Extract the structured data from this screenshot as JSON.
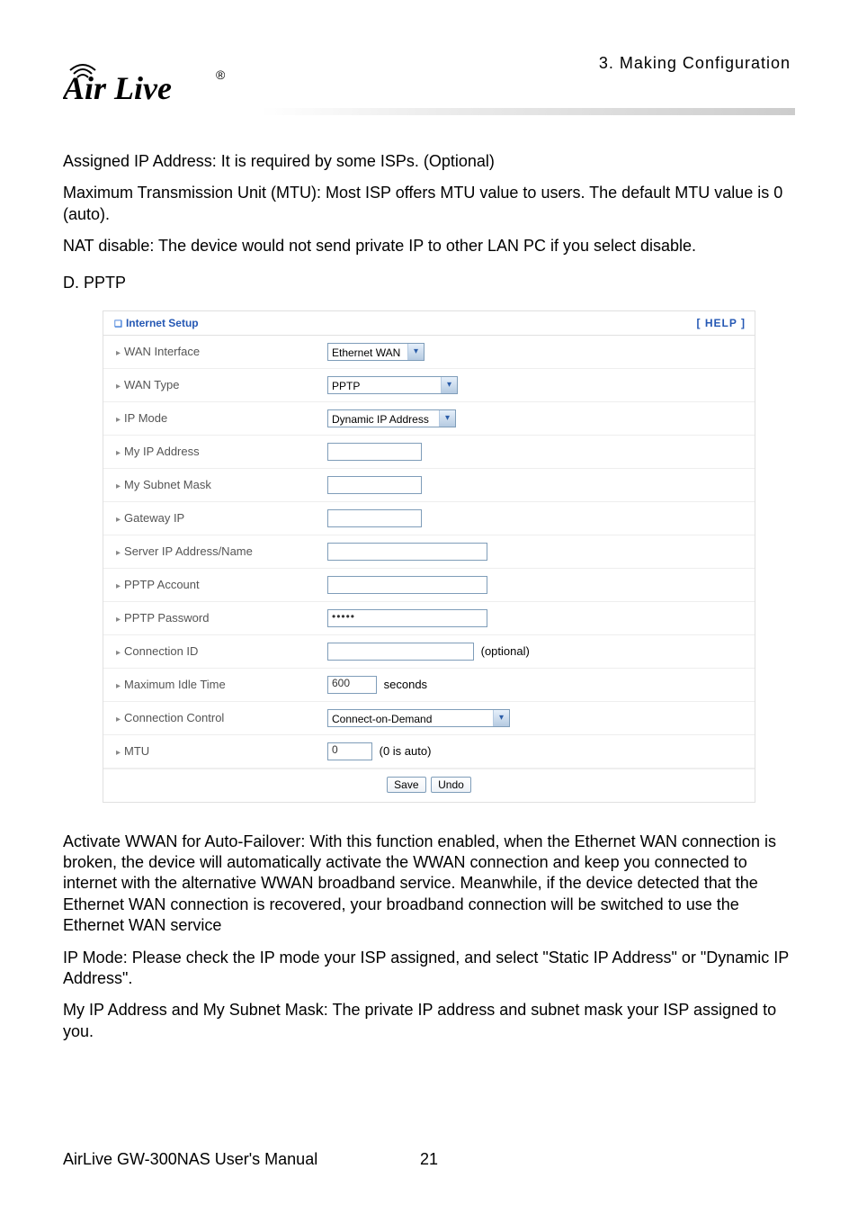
{
  "header": {
    "chapter": "3.  Making  Configuration",
    "logo_text": "Air Live",
    "logo_r": "®"
  },
  "intro": {
    "p1": "Assigned IP Address: It is required by some ISPs. (Optional)",
    "p2": "Maximum Transmission Unit (MTU): Most ISP offers MTU value to users. The default MTU value is 0 (auto).",
    "p3": "NAT disable: The device would not send private IP to other LAN PC if you select disable."
  },
  "section_d": "D. PPTP",
  "setup": {
    "title": "Internet Setup",
    "help": "[ HELP ]",
    "rows": {
      "wan_interface": {
        "label": "WAN Interface",
        "value": "Ethernet WAN"
      },
      "wan_type": {
        "label": "WAN Type",
        "value": "PPTP"
      },
      "ip_mode": {
        "label": "IP Mode",
        "value": "Dynamic IP Address"
      },
      "my_ip": {
        "label": "My IP Address",
        "value": ""
      },
      "my_subnet": {
        "label": "My Subnet Mask",
        "value": ""
      },
      "gateway_ip": {
        "label": "Gateway IP",
        "value": ""
      },
      "server_addr": {
        "label": "Server IP Address/Name",
        "value": ""
      },
      "pptp_account": {
        "label": "PPTP Account",
        "value": ""
      },
      "pptp_password": {
        "label": "PPTP Password",
        "value": "•••••"
      },
      "conn_id": {
        "label": "Connection ID",
        "value": "",
        "hint": "(optional)"
      },
      "max_idle": {
        "label": "Maximum Idle Time",
        "value": "600",
        "hint": "seconds"
      },
      "conn_control": {
        "label": "Connection Control",
        "value": "Connect-on-Demand"
      },
      "mtu": {
        "label": "MTU",
        "value": "0",
        "hint": "(0 is auto)"
      }
    },
    "buttons": {
      "save": "Save",
      "undo": "Undo"
    }
  },
  "after": {
    "p1": "Activate WWAN for Auto-Failover: With this function enabled, when the Ethernet WAN connection is broken, the device will automatically activate the WWAN connection and keep you connected to internet with the alternative WWAN broadband service. Meanwhile, if the device detected that the Ethernet WAN connection is recovered, your broadband connection will be switched to use the Ethernet WAN service",
    "p2": "IP Mode: Please check the IP mode your ISP assigned, and select \"Static IP Address\" or \"Dynamic IP Address\".",
    "p3": "My IP Address and My Subnet Mask: The private IP address and subnet mask your ISP assigned to you."
  },
  "footer": {
    "left": "AirLive GW-300NAS User's Manual",
    "page": "21"
  }
}
